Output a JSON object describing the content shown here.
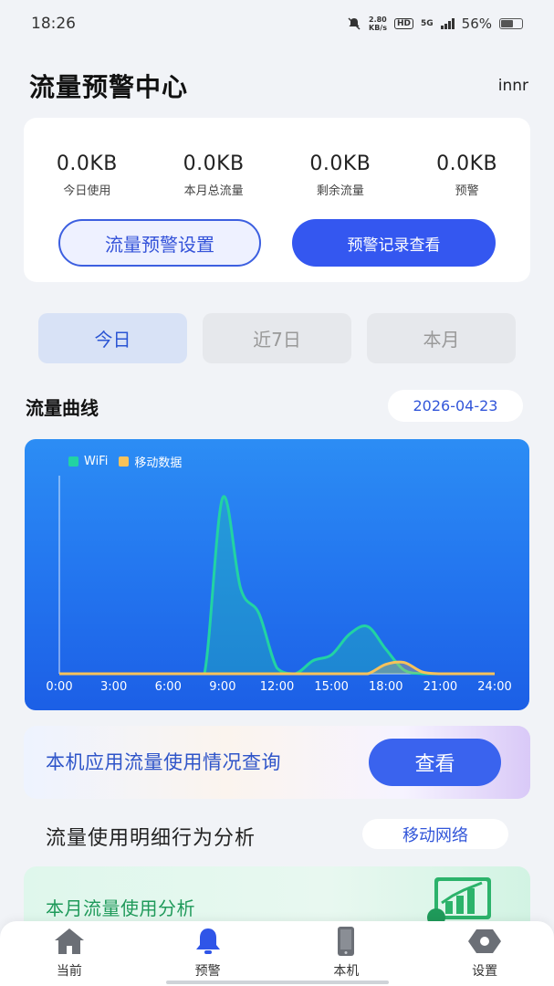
{
  "status_bar": {
    "time": "18:26",
    "net_speed_value": "2.80",
    "net_speed_unit": "KB/s",
    "hd": "HD",
    "network": "5G",
    "battery": "56%"
  },
  "header": {
    "title": "流量预警中心",
    "right_text": "innr"
  },
  "summary": {
    "stats": [
      {
        "value": "0.0KB",
        "label": "今日使用"
      },
      {
        "value": "0.0KB",
        "label": "本月总流量"
      },
      {
        "value": "0.0KB",
        "label": "剩余流量"
      },
      {
        "value": "0.0KB",
        "label": "预警"
      }
    ],
    "settings_button": "流量预警设置",
    "records_button": "预警记录查看"
  },
  "period_tabs": [
    {
      "label": "今日",
      "active": true
    },
    {
      "label": "近7日",
      "active": false
    },
    {
      "label": "本月",
      "active": false
    }
  ],
  "chart_section": {
    "title": "流量曲线",
    "date": "2026-04-23"
  },
  "chart_data": {
    "type": "area",
    "x": [
      0,
      1,
      2,
      3,
      4,
      5,
      6,
      7,
      8,
      9,
      10,
      11,
      12,
      13,
      14,
      15,
      16,
      17,
      18,
      19,
      20,
      21,
      22,
      23,
      24
    ],
    "tick_labels": [
      "0:00",
      "3:00",
      "6:00",
      "9:00",
      "12:00",
      "15:00",
      "18:00",
      "21:00",
      "24:00"
    ],
    "series": [
      {
        "name": "WiFi",
        "color": "#22d3a3",
        "values": [
          0,
          0,
          0,
          0,
          0,
          0,
          0,
          0,
          0,
          93,
          45,
          32,
          3,
          0,
          7,
          10,
          21,
          25,
          13,
          2,
          0,
          0,
          0,
          0,
          0
        ]
      },
      {
        "name": "移动数据",
        "color": "#f7c25a",
        "values": [
          0,
          0,
          0,
          0,
          0,
          0,
          0,
          0,
          0,
          0,
          0,
          0,
          0,
          0,
          0,
          0,
          0,
          0,
          5,
          6,
          1,
          0,
          0,
          0,
          0
        ]
      }
    ],
    "ylim": [
      0,
      100
    ],
    "grid": false,
    "legend": "top-left"
  },
  "query_banner": {
    "text": "本机应用流量使用情况查询",
    "button": "查看"
  },
  "analysis": {
    "title": "流量使用明细行为分析",
    "network_pill": "移动网络"
  },
  "monthly_card": {
    "text": "本月流量使用分析"
  },
  "tabbar": [
    {
      "label": "当前",
      "icon": "home-icon",
      "active": false
    },
    {
      "label": "预警",
      "icon": "bell-icon",
      "active": true
    },
    {
      "label": "本机",
      "icon": "phone-icon",
      "active": false
    },
    {
      "label": "设置",
      "icon": "settings-icon",
      "active": false
    }
  ],
  "colors": {
    "primary": "#3457f0",
    "chart_bg": "#2478f0",
    "wifi": "#22d3a3",
    "mobile": "#f7c25a",
    "bell_active": "#2f55e8"
  }
}
